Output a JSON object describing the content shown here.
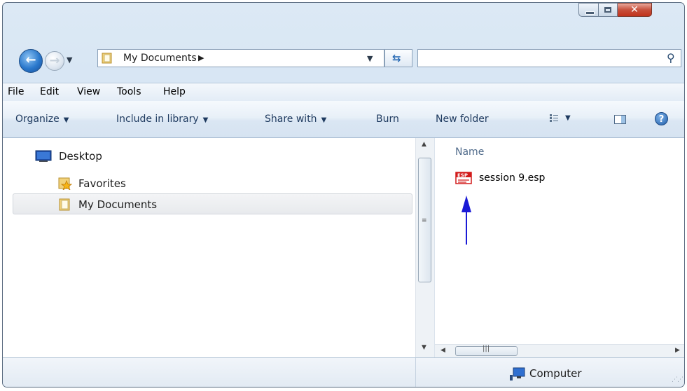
{
  "address": {
    "path": "My Documents"
  },
  "menu": [
    "File",
    "Edit",
    "View",
    "Tools",
    "Help"
  ],
  "toolbar": {
    "organize": "Organize",
    "include_in_library": "Include in library",
    "share_with": "Share with",
    "burn": "Burn",
    "new_folder": "New folder"
  },
  "navigation": {
    "items": [
      {
        "label": "Desktop",
        "icon": "desktop-icon"
      },
      {
        "label": "Favorites",
        "icon": "favorites-folder-icon"
      },
      {
        "label": "My Documents",
        "icon": "folder-icon",
        "selected": true
      }
    ]
  },
  "file_list": {
    "column_name": "Name",
    "files": [
      {
        "name": "session 9.esp",
        "icon": "esp-file-icon"
      }
    ]
  },
  "status": {
    "location": "Computer"
  },
  "colors": {
    "accent": "#1f5ca8",
    "annotation_arrow": "#1a1ad6",
    "close_button": "#c7503c"
  }
}
